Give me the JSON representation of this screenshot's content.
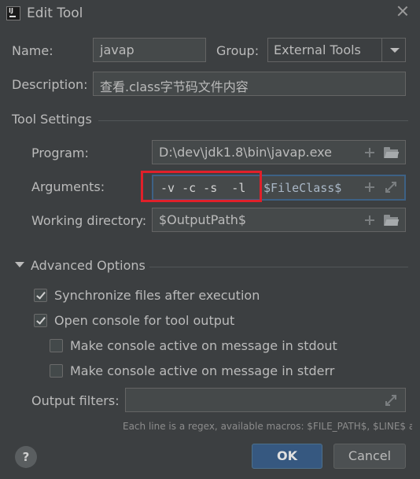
{
  "window": {
    "title": "Edit Tool",
    "icon": "intellij-idea-icon",
    "icon_text": "IJ"
  },
  "form": {
    "name_label": "Name:",
    "name_value": "javap",
    "group_label": "Group:",
    "group_value": "External Tools",
    "description_label": "Description:",
    "description_value": "查看.class字节码文件内容"
  },
  "tool_settings": {
    "title": "Tool Settings",
    "program_label": "Program:",
    "program_value": "D:\\dev\\jdk1.8\\bin\\javap.exe",
    "arguments_label": "Arguments:",
    "arguments_flags": "-v -c -s  -l",
    "arguments_macro": "$FileClass$",
    "working_dir_label": "Working directory:",
    "working_dir_value": "$OutputPath$"
  },
  "advanced": {
    "title": "Advanced Options",
    "options": [
      {
        "label": "Synchronize files after execution",
        "checked": true
      },
      {
        "label": "Open console for tool output",
        "checked": true
      },
      {
        "label": "Make console active on message in stdout",
        "checked": false
      },
      {
        "label": "Make console active on message in stderr",
        "checked": false
      }
    ],
    "output_filters_label": "Output filters:",
    "output_filters_value": "",
    "hint": "Each line is a regex, available macros: $FILE_PATH$, $LINE$ and $COLUMN$"
  },
  "buttons": {
    "help": "?",
    "ok": "OK",
    "cancel": "Cancel"
  },
  "colors": {
    "background": "#3c3f41",
    "text": "#bbbbbb",
    "field_bg": "#45494a",
    "focus_border": "#3d6185",
    "highlight_annotation": "#e0202a",
    "ok_button": "#365880"
  }
}
